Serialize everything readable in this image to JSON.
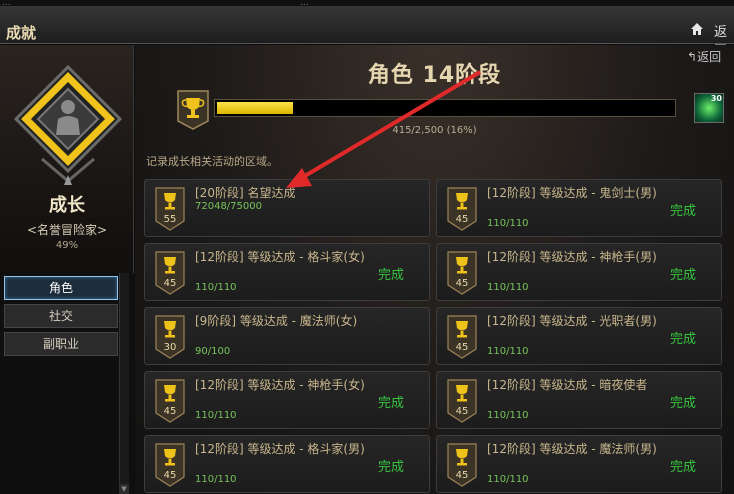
{
  "window": {
    "title": "成就",
    "back_label": "返回",
    "cut_left_text": "...",
    "cut_mid_text": "..."
  },
  "sidebar": {
    "category_name": "成长",
    "rank_title": "<名誉冒险家>",
    "rank_percent": "49%",
    "nav_items": [
      {
        "label": "角色",
        "active": true
      },
      {
        "label": "社交",
        "active": false
      },
      {
        "label": "副职业",
        "active": false
      }
    ]
  },
  "main": {
    "back_link": "返回",
    "stage_title": "角色 14阶段",
    "progress": {
      "current": 415,
      "total": 2500,
      "fraction": 0.166,
      "text": "415/2,500 (16%)"
    },
    "reward": {
      "count": "30"
    },
    "hint": "记录成长相关活动的区域。",
    "achievements": [
      {
        "badge": "55",
        "title": "[20阶段] 名望达成",
        "progress": "72048/75000",
        "status": ""
      },
      {
        "badge": "45",
        "title": "[12阶段] 等级达成 - 鬼剑士(男)",
        "progress": "110/110",
        "status": "完成"
      },
      {
        "badge": "45",
        "title": "[12阶段] 等级达成 - 格斗家(女)",
        "progress": "110/110",
        "status": "完成"
      },
      {
        "badge": "45",
        "title": "[12阶段] 等级达成 - 神枪手(男)",
        "progress": "110/110",
        "status": "完成"
      },
      {
        "badge": "30",
        "title": "[9阶段] 等级达成 - 魔法师(女)",
        "progress": "90/100",
        "status": ""
      },
      {
        "badge": "45",
        "title": "[12阶段] 等级达成 - 光职者(男)",
        "progress": "110/110",
        "status": "完成"
      },
      {
        "badge": "45",
        "title": "[12阶段] 等级达成 - 神枪手(女)",
        "progress": "110/110",
        "status": "完成"
      },
      {
        "badge": "45",
        "title": "[12阶段] 等级达成 - 暗夜使者",
        "progress": "110/110",
        "status": "完成"
      },
      {
        "badge": "45",
        "title": "[12阶段] 等级达成 - 格斗家(男)",
        "progress": "110/110",
        "status": "完成"
      },
      {
        "badge": "45",
        "title": "[12阶段] 等级达成 - 魔法师(男)",
        "progress": "110/110",
        "status": "完成"
      }
    ]
  },
  "colors": {
    "accent_gold": "#f0c21c",
    "progress_fill": "#f5d21e",
    "complete_green": "#38c43f",
    "progress_green": "#79c35a",
    "active_tab_border": "#8fc3ec",
    "annotation_arrow": "#e02a2a"
  },
  "icons": [
    "home-icon",
    "trophy-icon",
    "reward-box-icon",
    "person-silhouette-icon",
    "scroll-down-icon"
  ]
}
